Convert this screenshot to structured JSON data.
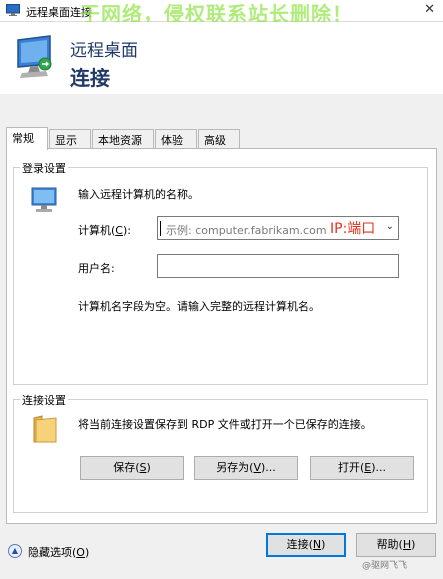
{
  "window": {
    "title": "远程桌面连接",
    "close_glyph": "✕"
  },
  "watermark_top": "于网络，侵权联系站长删除！",
  "header": {
    "subtitle": "远程桌面",
    "title": "连接"
  },
  "tabs": [
    {
      "label": "常规",
      "active": true
    },
    {
      "label": "显示",
      "active": false
    },
    {
      "label": "本地资源",
      "active": false
    },
    {
      "label": "体验",
      "active": false
    },
    {
      "label": "高级",
      "active": false
    }
  ],
  "login_group": {
    "label": "登录设置",
    "instruction": "输入远程计算机的名称。",
    "computer_label": "计算机(",
    "computer_accel": "C",
    "computer_label_end": "):",
    "computer_placeholder": "示例: computer.fabrikam.com",
    "annotation": "IP:端口",
    "username_label": "用户名:",
    "username_value": "",
    "hint": "计算机名字段为空。请输入完整的远程计算机名。"
  },
  "connection_group": {
    "label": "连接设置",
    "description": "将当前连接设置保存到 RDP 文件或打开一个已保存的连接。",
    "save": {
      "text": "保存(",
      "accel": "S",
      "end": ")"
    },
    "save_as": {
      "text": "另存为(",
      "accel": "V",
      "end": ")..."
    },
    "open": {
      "text": "打开(",
      "accel": "E",
      "end": ")..."
    }
  },
  "footer": {
    "hide_options": {
      "text": "隐藏选项(",
      "accel": "O",
      "end": ")"
    },
    "connect": {
      "text": "连接(",
      "accel": "N",
      "end": ")"
    },
    "help": {
      "text": "帮助(",
      "accel": "H",
      "end": ")"
    }
  },
  "corner_watermark": "@驱网飞飞",
  "colors": {
    "header_text": "#1f3a68",
    "annotation": "#e8301c",
    "default_button_border": "#0078d7"
  },
  "icons": {
    "app": "remote-desktop-icon",
    "login": "computer-monitor-icon",
    "connection": "folder-icon",
    "toggle": "chevron-up-icon"
  }
}
